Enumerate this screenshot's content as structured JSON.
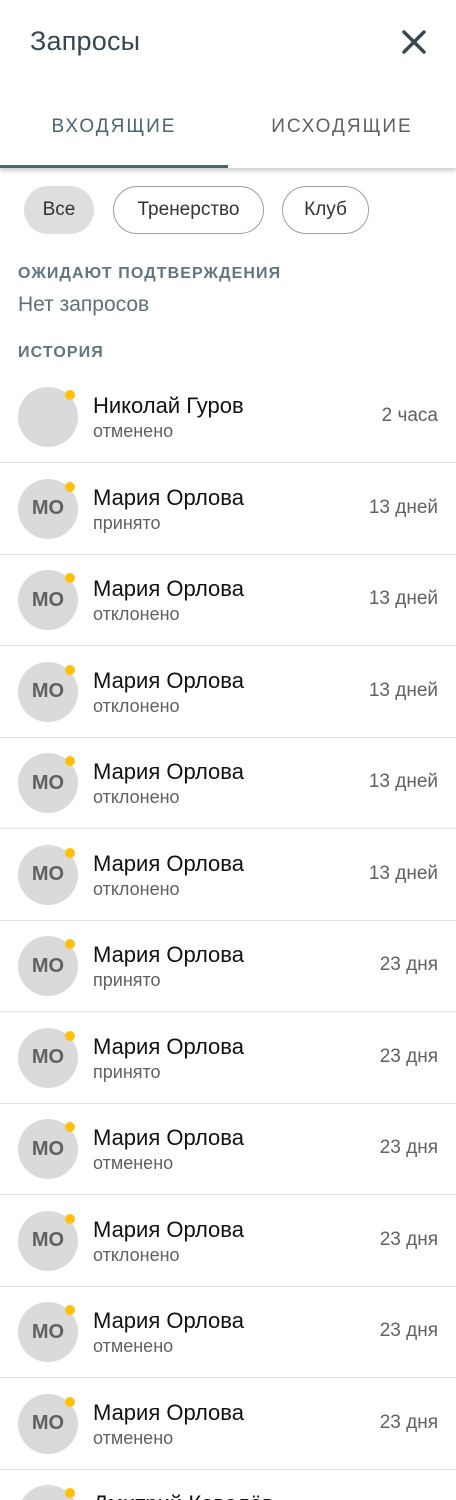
{
  "header": {
    "title": "Запросы",
    "close_icon": "close-icon"
  },
  "tabs": [
    {
      "label": "ВХОДЯЩИЕ",
      "active": true
    },
    {
      "label": "ИСХОДЯЩИЕ",
      "active": false
    }
  ],
  "filters": [
    {
      "label": "Все",
      "selected": true
    },
    {
      "label": "Тренерство",
      "selected": false
    },
    {
      "label": "Клуб",
      "selected": false
    }
  ],
  "pending": {
    "heading": "ОЖИДАЮТ ПОДТВЕРЖДЕНИЯ",
    "empty_text": "Нет запросов"
  },
  "history": {
    "heading": "ИСТОРИЯ",
    "items": [
      {
        "initials": "",
        "name": "Николай Гуров",
        "status": "отменено",
        "time": "2 часа"
      },
      {
        "initials": "МО",
        "name": "Мария Орлова",
        "status": "принято",
        "time": "13 дней"
      },
      {
        "initials": "МО",
        "name": "Мария Орлова",
        "status": "отклонено",
        "time": "13 дней"
      },
      {
        "initials": "МО",
        "name": "Мария Орлова",
        "status": "отклонено",
        "time": "13 дней"
      },
      {
        "initials": "МО",
        "name": "Мария Орлова",
        "status": "отклонено",
        "time": "13 дней"
      },
      {
        "initials": "МО",
        "name": "Мария Орлова",
        "status": "отклонено",
        "time": "13 дней"
      },
      {
        "initials": "МО",
        "name": "Мария Орлова",
        "status": "принято",
        "time": "23 дня"
      },
      {
        "initials": "МО",
        "name": "Мария Орлова",
        "status": "принято",
        "time": "23 дня"
      },
      {
        "initials": "МО",
        "name": "Мария Орлова",
        "status": "отменено",
        "time": "23 дня"
      },
      {
        "initials": "МО",
        "name": "Мария Орлова",
        "status": "отклонено",
        "time": "23 дня"
      },
      {
        "initials": "МО",
        "name": "Мария Орлова",
        "status": "отменено",
        "time": "23 дня"
      },
      {
        "initials": "МО",
        "name": "Мария Орлова",
        "status": "отменено",
        "time": "23 дня"
      },
      {
        "initials": "",
        "name": "Дмитрий Ковалёв",
        "status": "",
        "time": ""
      }
    ]
  },
  "colors": {
    "accent": "#4b6470",
    "unread_dot": "#ffc107",
    "avatar_bg": "#dadada"
  }
}
